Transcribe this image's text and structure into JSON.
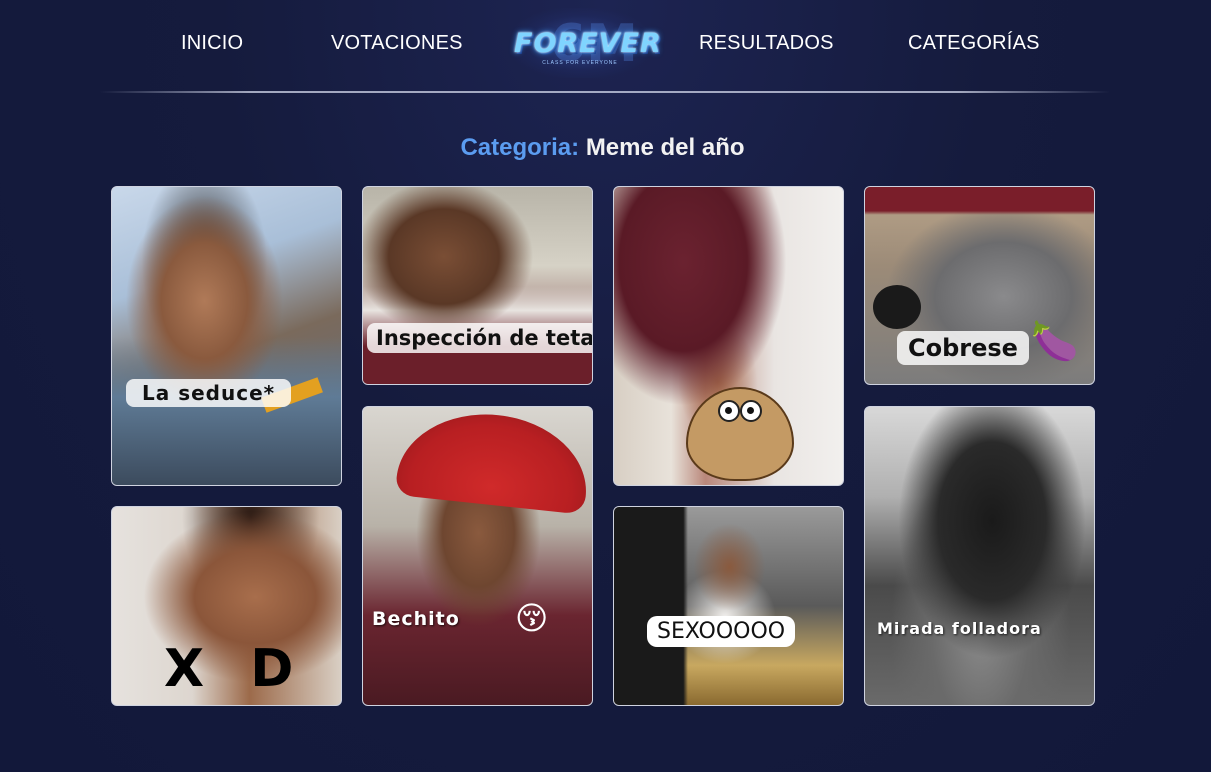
{
  "nav": {
    "inicio": "INICIO",
    "votaciones": "VOTACIONES",
    "resultados": "RESULTADOS",
    "categorias": "CATEGORÍAS",
    "logo_text": "FOREVER",
    "logo_sub": "CLASS FOR EVERYONE",
    "logo_mark": "6M"
  },
  "page": {
    "category_label": "Categoria:",
    "category_name": "Meme del año"
  },
  "cards": [
    {
      "caption": "La seduce*"
    },
    {
      "caption": "Inspección de tetas"
    },
    {
      "caption": ""
    },
    {
      "caption": "Cobrese",
      "emoji": "🍆"
    },
    {
      "caption": "X D"
    },
    {
      "caption": "Bechito",
      "emoji": "😚"
    },
    {
      "caption": "SEXOOOOO"
    },
    {
      "caption": "Mirada folladora"
    }
  ],
  "colors": {
    "background": "#151b3d",
    "accent": "#5b9cf0",
    "logo": "#7fd4ff",
    "card_border": "#cfd3e0"
  }
}
